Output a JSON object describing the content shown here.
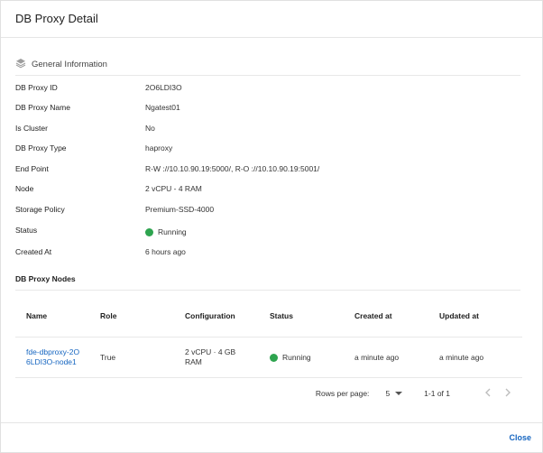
{
  "dialog": {
    "title": "DB Proxy Detail",
    "close_label": "Close"
  },
  "general": {
    "section_title": "General Information",
    "rows": [
      {
        "label": "DB Proxy ID",
        "value": "2O6LDI3O"
      },
      {
        "label": "DB Proxy Name",
        "value": "Ngatest01"
      },
      {
        "label": "Is Cluster",
        "value": "No"
      },
      {
        "label": "DB Proxy Type",
        "value": "haproxy"
      },
      {
        "label": "End Point",
        "value": "R-W ://10.10.90.19:5000/, R-O ://10.10.90.19:5001/"
      },
      {
        "label": "Node",
        "value": "2 vCPU - 4 RAM"
      },
      {
        "label": "Storage Policy",
        "value": "Premium-SSD-4000"
      },
      {
        "label": "Status",
        "value": "Running"
      },
      {
        "label": "Created At",
        "value": "6 hours ago"
      }
    ]
  },
  "nodes": {
    "section_title": "DB Proxy Nodes",
    "columns": [
      "Name",
      "Role",
      "Configuration",
      "Status",
      "Created at",
      "Updated at"
    ],
    "rows": [
      {
        "name": "fde-dbproxy-2O6LDI3O-node1",
        "role": "True",
        "configuration": "2 vCPU · 4 GB RAM",
        "status": "Running",
        "created_at": "a minute ago",
        "updated_at": "a minute ago"
      }
    ],
    "pagination": {
      "rows_per_page_label": "Rows per page:",
      "rows_per_page_value": "5",
      "range": "1-1 of 1"
    }
  },
  "colors": {
    "status_running": "#2ea44f",
    "link": "#1565c0"
  }
}
